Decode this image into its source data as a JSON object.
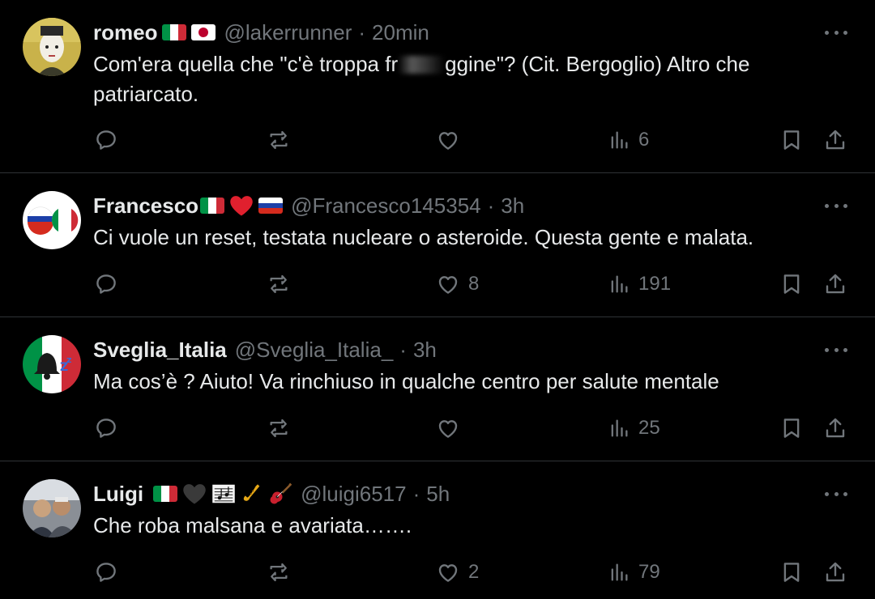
{
  "posts": [
    {
      "name": "romeo",
      "handle": "@lakerrunner",
      "separator": "·",
      "time": "20min",
      "text_part1": "Com'era quella che \"c'è troppa fr",
      "text_part2": "ggine\"?  (Cit. Bergoglio) Altro che patriarcato.",
      "emojis": [
        "italy-flag",
        "japan-flag"
      ],
      "stats": {
        "replies": "",
        "reposts": "",
        "likes": "",
        "views": "6"
      }
    },
    {
      "name": "Francesco",
      "handle": "@Francesco145354",
      "separator": "·",
      "time": "3h",
      "text": "Ci vuole un reset, testata nucleare o asteroide. Questa gente e malata.",
      "emojis": [
        "italy-flag",
        "red-heart",
        "russia-flag"
      ],
      "stats": {
        "replies": "",
        "reposts": "",
        "likes": "8",
        "views": "191"
      }
    },
    {
      "name": "Sveglia_Italia",
      "handle": "@Sveglia_Italia_",
      "separator": "·",
      "time": "3h",
      "text": "Ma cos’è ? Aiuto! Va rinchiuso in qualche centro per salute mentale",
      "emojis": [],
      "stats": {
        "replies": "",
        "reposts": "",
        "likes": "",
        "views": "25"
      }
    },
    {
      "name": "Luigi",
      "handle": "@luigi6517",
      "separator": "·",
      "time": "5h",
      "text": "Che roba malsana e avariata…….",
      "emojis": [
        "italy-flag",
        "black-heart",
        "musical-score",
        "saxophone",
        "guitar"
      ],
      "stats": {
        "replies": "",
        "reposts": "",
        "likes": "2",
        "views": "79"
      }
    }
  ],
  "colors": {
    "background": "#000000",
    "text": "#e7e9ea",
    "secondary": "#71767b",
    "divider": "#2f3336"
  }
}
